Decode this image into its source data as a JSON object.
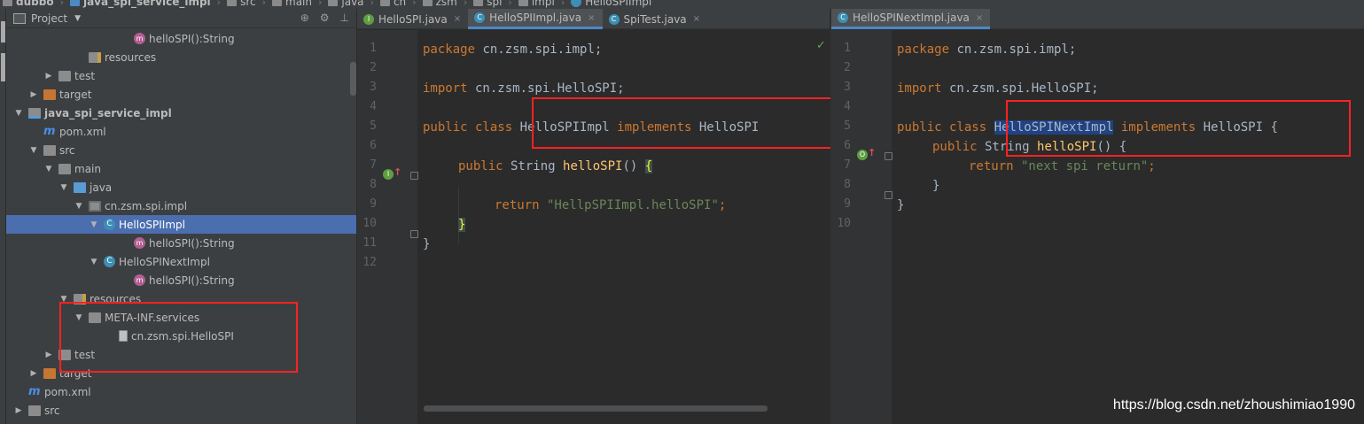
{
  "breadcrumbs": [
    {
      "label": "dubbo",
      "bold": true,
      "icon": "folder-icon"
    },
    {
      "label": "java_spi_service_impl",
      "bold": true,
      "icon": "module-icon"
    },
    {
      "label": "src",
      "bold": false,
      "icon": "folder-icon"
    },
    {
      "label": "main",
      "bold": false,
      "icon": "folder-icon"
    },
    {
      "label": "java",
      "bold": false,
      "icon": "folder-icon"
    },
    {
      "label": "cn",
      "bold": false,
      "icon": "package-icon"
    },
    {
      "label": "zsm",
      "bold": false,
      "icon": "package-icon"
    },
    {
      "label": "spi",
      "bold": false,
      "icon": "package-icon"
    },
    {
      "label": "impl",
      "bold": false,
      "icon": "package-icon"
    },
    {
      "label": "HelloSPIImpl",
      "bold": false,
      "icon": "class-icon"
    }
  ],
  "project_panel": {
    "title": "Project",
    "tools": [
      "⊕",
      "⚙",
      "⊥"
    ],
    "tree": [
      {
        "label": "helloSPI():String",
        "depth": 8,
        "icon": "method-icon",
        "arrow": ""
      },
      {
        "label": "resources",
        "depth": 5,
        "icon": "resources-folder-icon",
        "arrow": ""
      },
      {
        "label": "test",
        "depth": 3,
        "icon": "folder-icon",
        "arrow": "right"
      },
      {
        "label": "target",
        "depth": 2,
        "icon": "orange-folder-icon",
        "arrow": "right"
      },
      {
        "label": "java_spi_service_impl",
        "depth": 1,
        "icon": "module-icon",
        "arrow": "down",
        "bold": true
      },
      {
        "label": "pom.xml",
        "depth": 2,
        "icon": "maven-icon",
        "arrow": ""
      },
      {
        "label": "src",
        "depth": 2,
        "icon": "folder-icon",
        "arrow": "down"
      },
      {
        "label": "main",
        "depth": 3,
        "icon": "folder-icon",
        "arrow": "down"
      },
      {
        "label": "java",
        "depth": 4,
        "icon": "blue-folder-icon",
        "arrow": "down"
      },
      {
        "label": "cn.zsm.spi.impl",
        "depth": 5,
        "icon": "package-icon",
        "arrow": "down"
      },
      {
        "label": "HelloSPIImpl",
        "depth": 6,
        "icon": "class-icon",
        "arrow": "down",
        "selected": true
      },
      {
        "label": "helloSPI():String",
        "depth": 8,
        "icon": "method-icon",
        "arrow": ""
      },
      {
        "label": "HelloSPINextImpl",
        "depth": 6,
        "icon": "class-icon",
        "arrow": "down"
      },
      {
        "label": "helloSPI():String",
        "depth": 8,
        "icon": "method-icon",
        "arrow": ""
      },
      {
        "label": "resources",
        "depth": 4,
        "icon": "resources-folder-icon",
        "arrow": "down"
      },
      {
        "label": "META-INF.services",
        "depth": 5,
        "icon": "folder-icon",
        "arrow": "down"
      },
      {
        "label": "cn.zsm.spi.HelloSPI",
        "depth": 7,
        "icon": "file-icon",
        "arrow": ""
      },
      {
        "label": "test",
        "depth": 3,
        "icon": "folder-icon",
        "arrow": "right"
      },
      {
        "label": "target",
        "depth": 2,
        "icon": "orange-folder-icon",
        "arrow": "right"
      },
      {
        "label": "pom.xml",
        "depth": 1,
        "icon": "maven-icon",
        "arrow": ""
      },
      {
        "label": "src",
        "depth": 1,
        "icon": "folder-icon",
        "arrow": "right"
      }
    ]
  },
  "left_editor": {
    "tabs": [
      {
        "label": "HelloSPI.java",
        "icon": "interface-icon",
        "active": false
      },
      {
        "label": "HelloSPIImpl.java",
        "icon": "class-icon",
        "active": true
      },
      {
        "label": "SpiTest.java",
        "icon": "class-icon",
        "active": false
      }
    ],
    "line_numbers": [
      "1",
      "2",
      "3",
      "4",
      "5",
      "6",
      "7",
      "8",
      "9",
      "10",
      "11",
      "12"
    ],
    "lines": {
      "l1": {
        "kw": "package",
        "rest": " cn.zsm.spi.impl;"
      },
      "l3": {
        "kw": "import",
        "rest": " cn.zsm.spi.HelloSPI;"
      },
      "l5": {
        "kw1": "public",
        "kw2": " class",
        "name": " HelloSPIImpl",
        "kw3": " implements",
        "iface": " HelloSPI"
      },
      "l7": {
        "kw1": "public",
        "type": " String ",
        "fn": "helloSPI",
        "rest": "() ",
        "brace": "{"
      },
      "l9": {
        "kw": "return",
        "str": " \"HellpSPIImpl.helloSPI\"",
        "semi": ";"
      },
      "l10": {
        "brace": "}"
      },
      "l11": {
        "brace": "}"
      }
    }
  },
  "right_editor": {
    "tabs": [
      {
        "label": "HelloSPINextImpl.java",
        "icon": "class-icon",
        "active": true
      }
    ],
    "line_numbers": [
      "1",
      "2",
      "3",
      "4",
      "5",
      "6",
      "7",
      "8",
      "9",
      "10"
    ],
    "lines": {
      "l1": {
        "kw": "package",
        "rest": " cn.zsm.spi.impl;"
      },
      "l3": {
        "kw": "import",
        "rest": " cn.zsm.spi.HelloSPI;"
      },
      "l5": {
        "kw1": "public",
        "kw2": " class",
        "name": "HelloSPINextImpl",
        "kw3": " implements",
        "iface": " HelloSPI {"
      },
      "l6": {
        "kw1": "public",
        "type": " String ",
        "fn": "helloSPI",
        "rest": "() {"
      },
      "l7": {
        "kw": "return",
        "str": " \"next spi return\"",
        "semi": ";"
      },
      "l8": {
        "brace": "}"
      },
      "l9": {
        "brace": "}"
      }
    }
  },
  "watermark": "https://blog.csdn.net/zhoushimiao1990",
  "colors": {
    "highlight_box": "#ff2222",
    "selection": "#4b6eaf",
    "keyword": "#cc7832",
    "string": "#6a8759",
    "function": "#ffc66d"
  }
}
